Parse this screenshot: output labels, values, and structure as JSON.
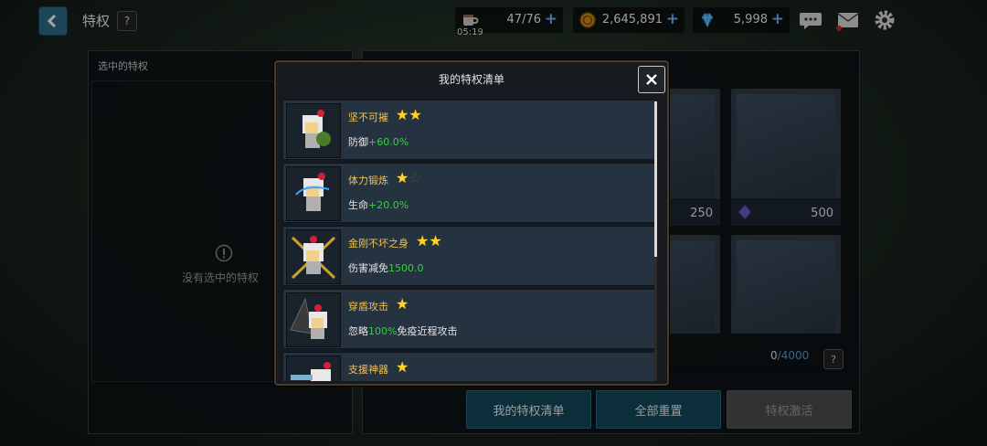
{
  "header": {
    "title": "特权",
    "help": "?",
    "stamina": {
      "value": "47/76",
      "timer": "05:19"
    },
    "gold": {
      "value": "2,645,891"
    },
    "gems": {
      "value": "5,998"
    }
  },
  "left_panel": {
    "title": "选中的特权",
    "empty_text": "没有选中的特权"
  },
  "right_panel": {
    "cards": [
      {
        "cost": "250"
      },
      {
        "cost": "500"
      }
    ],
    "progress": {
      "current": "0",
      "max": "4000",
      "fraction": 0
    },
    "help": "?"
  },
  "buttons": {
    "my_list": "我的特权清单",
    "reset_all": "全部重置",
    "activate": "特权激活"
  },
  "dialog": {
    "title": "我的特权清单",
    "perks": [
      {
        "name": "坚不可摧",
        "stars": 2,
        "max_stars": 2,
        "desc_prefix": "防御",
        "desc_value": "+60.0%",
        "desc_suffix": ""
      },
      {
        "name": "体力锻炼",
        "stars": 1,
        "max_stars": 2,
        "desc_prefix": "生命",
        "desc_value": "+20.0%",
        "desc_suffix": ""
      },
      {
        "name": "金刚不坏之身",
        "stars": 2,
        "max_stars": 2,
        "desc_prefix": "伤害减免",
        "desc_value": "1500.0",
        "desc_suffix": ""
      },
      {
        "name": "穿盾攻击",
        "stars": 1,
        "max_stars": 1,
        "desc_prefix": "忽略",
        "desc_value": "100%",
        "desc_suffix": "免疫近程攻击"
      },
      {
        "name": "支援神器",
        "stars": 1,
        "max_stars": 1,
        "desc_prefix": "",
        "desc_value": "",
        "desc_suffix": ""
      }
    ]
  },
  "colors": {
    "accent_gold_text": "#f2c14e",
    "positive_value": "#34d13a",
    "star": "#ffd42a",
    "teal_button": "#12485a"
  },
  "icons": [
    "back-arrow-icon",
    "stamina-cup-icon",
    "gold-coin-icon",
    "gem-icon",
    "chat-icon",
    "mail-icon",
    "gear-icon",
    "warning-icon",
    "close-icon",
    "star-icon"
  ]
}
